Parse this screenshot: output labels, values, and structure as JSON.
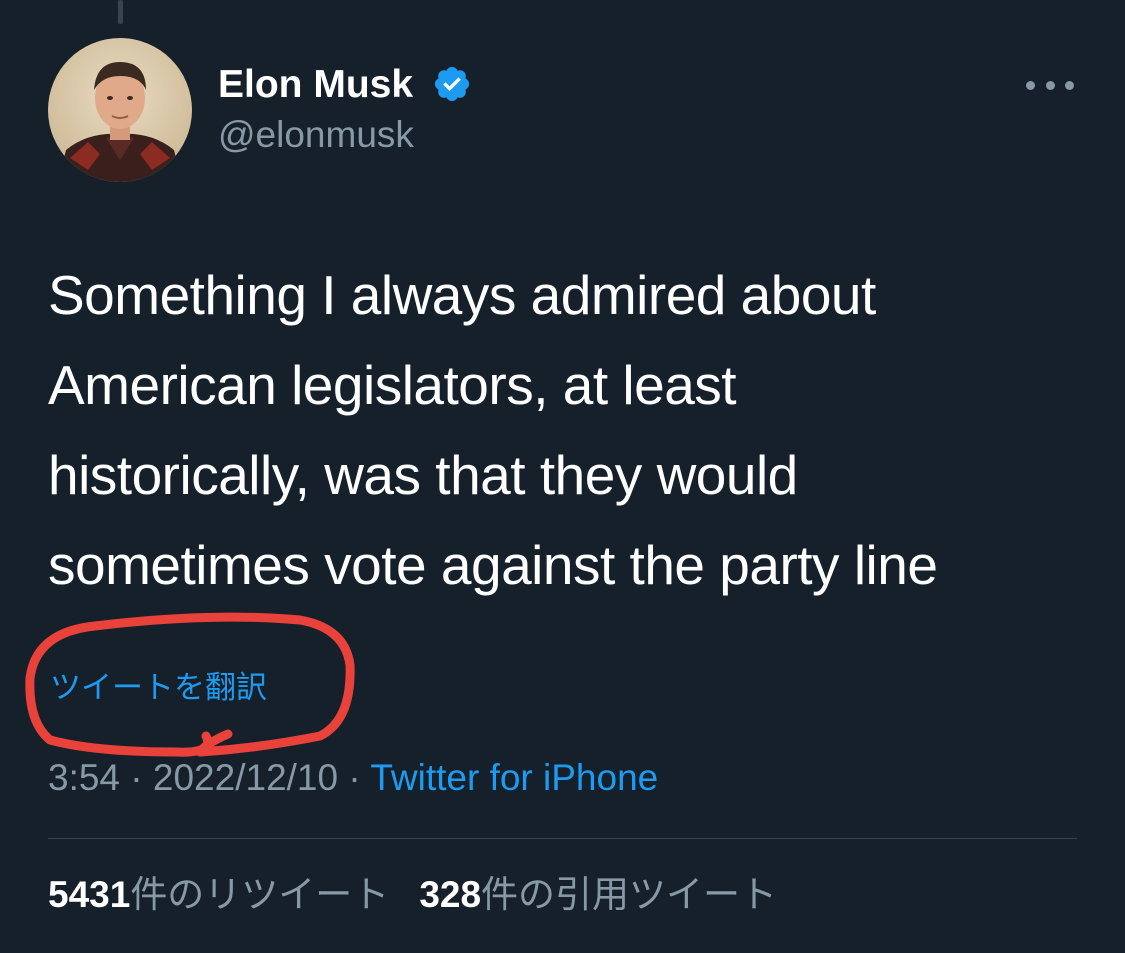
{
  "author": {
    "name": "Elon Musk",
    "handle": "@elonmusk",
    "verified": true
  },
  "tweet": {
    "text": "Something I always admired about\nAmerican legislators, at least\nhistorically, was that they would\nsometimes vote against the party line",
    "translate_label": "ツイートを翻訳",
    "time": "3:54",
    "date": "2022/12/10",
    "separator": " · ",
    "source": "Twitter for iPhone"
  },
  "stats": {
    "retweets_count": "5431",
    "retweets_label": "件のリツイート",
    "quotes_count": "328",
    "quotes_label": "件の引用ツイート"
  },
  "icons": {
    "verified": "verified-badge-icon",
    "more": "more-horizontal-icon"
  },
  "colors": {
    "background": "#15202b",
    "link": "#1d9bf0",
    "secondary_text": "#8899a6",
    "verified_badge": "#1d9bf0",
    "annotation_marker": "#e8423a"
  }
}
